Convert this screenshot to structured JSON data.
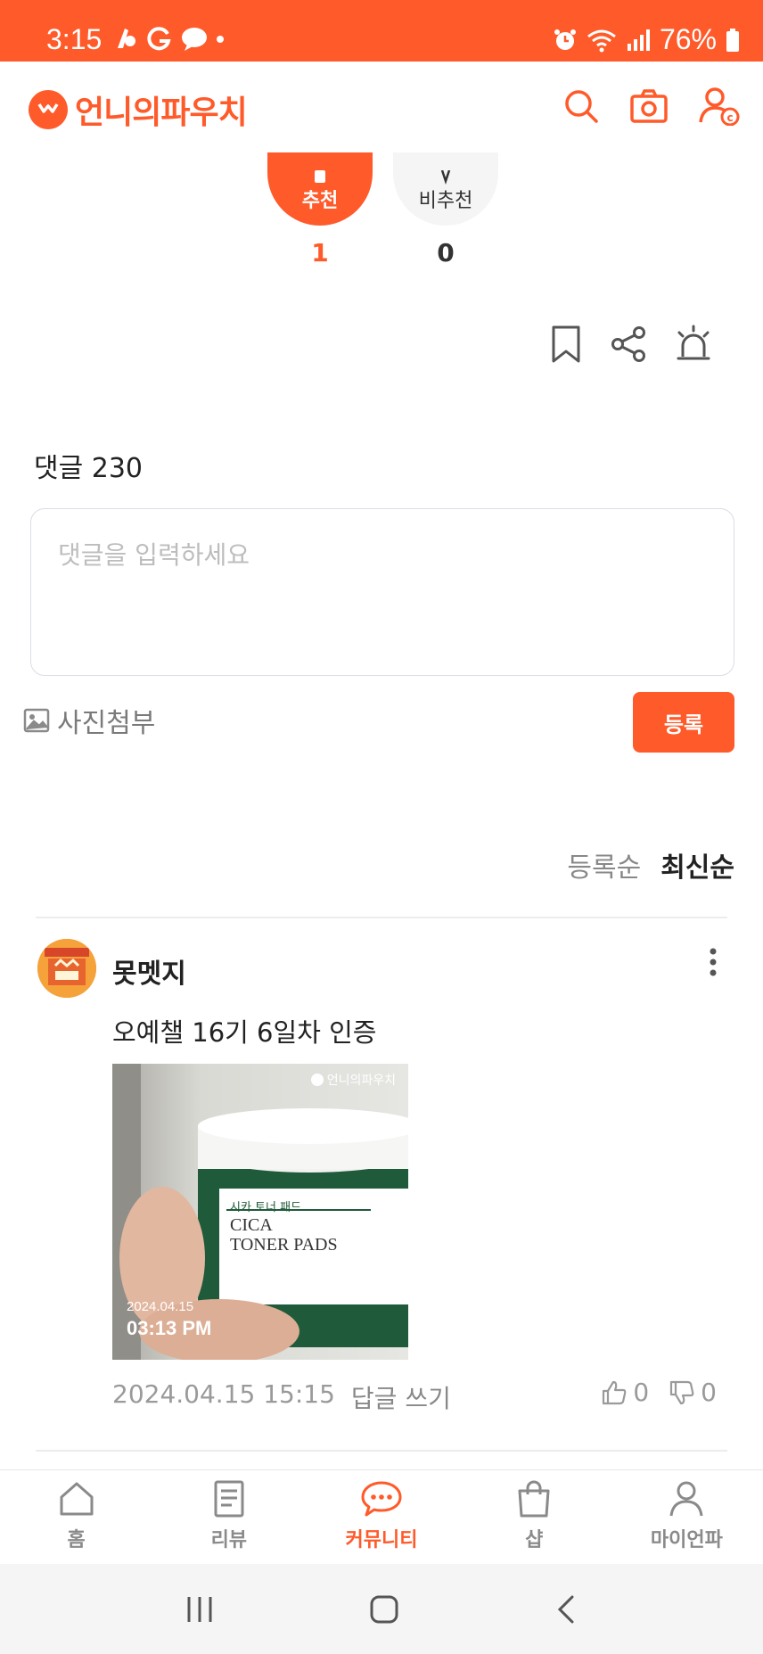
{
  "status_bar": {
    "time": "3:15",
    "battery": "76%"
  },
  "header": {
    "logo_text": "언니의파우치",
    "brand_color": "#ff5a2a"
  },
  "votes": {
    "up_label": "추천",
    "up_count": "1",
    "down_label": "비추천",
    "down_count": "0"
  },
  "comments": {
    "title": "댓글 230",
    "input_placeholder": "댓글을 입력하세요",
    "attach_label": "사진첨부",
    "submit_label": "등록",
    "sort_options": [
      "등록순",
      "최신순"
    ],
    "items": [
      {
        "author": "못멧지",
        "text": "오예챌 16기 6일차 인증",
        "photo_watermark": "언니의파우치",
        "photo_date": "2024.04.15",
        "photo_time": "03:13 PM",
        "photo_label_ko": "시카 토너 패드",
        "photo_label_en1": "CICA",
        "photo_label_en2": "TONER PADS",
        "timestamp": "2024.04.15 15:15",
        "reply_label": "답글 쓰기",
        "likes": "0",
        "dislikes": "0"
      }
    ]
  },
  "tabs": [
    {
      "label": "홈",
      "icon": "home-icon"
    },
    {
      "label": "리뷰",
      "icon": "document-icon"
    },
    {
      "label": "커뮤니티",
      "icon": "chat-bubble-icon",
      "active": true
    },
    {
      "label": "샵",
      "icon": "shopping-bag-icon"
    },
    {
      "label": "마이언파",
      "icon": "person-icon"
    }
  ]
}
